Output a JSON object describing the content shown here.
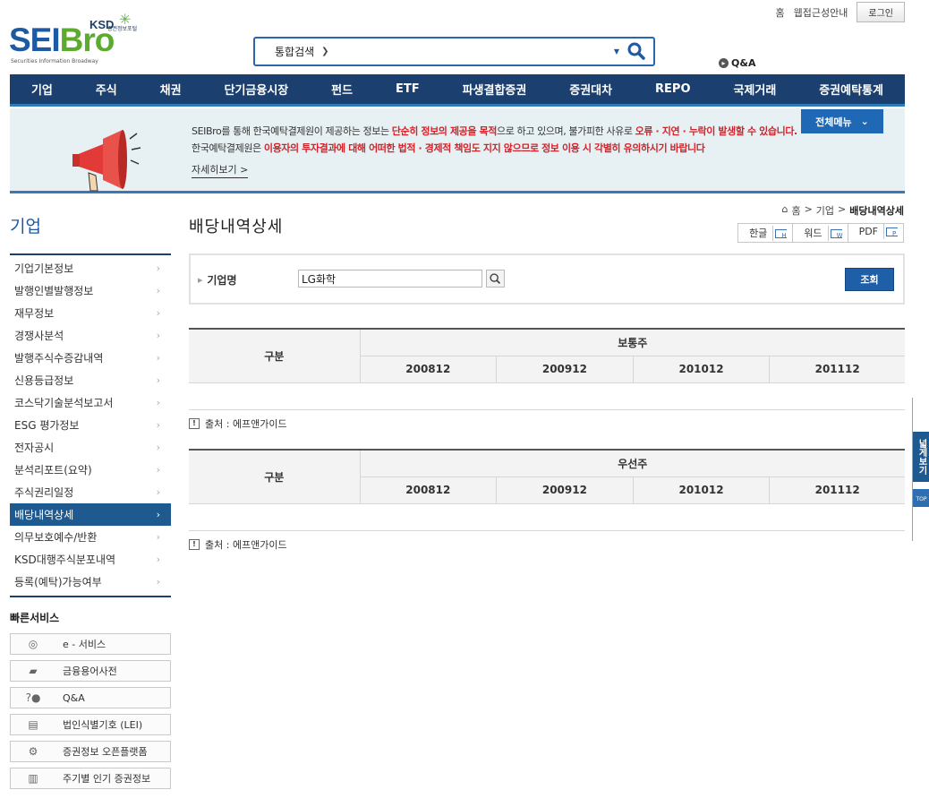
{
  "util": {
    "home": "홈",
    "accessibility": "웹접근성안내",
    "login": "로그인"
  },
  "logo": {
    "ksd": "KSD",
    "portal": "증권정보포털",
    "seibro_sei": "SEI",
    "seibro_bro": "Bro",
    "tagline": "Securities Information Broadway"
  },
  "search": {
    "category": "통합검색"
  },
  "qna_top": "Q&A",
  "gnb": [
    "기업",
    "주식",
    "채권",
    "단기금융시장",
    "펀드",
    "ETF",
    "파생결합증권",
    "증권대차",
    "REPO",
    "국제거래",
    "증권예탁통계"
  ],
  "notice": {
    "l1_a": "SEIBro를 통해 한국예탁결제원이 제공하는 정보는 ",
    "l1_b": "단순히 정보의 제공을 목적",
    "l1_c": "으로 하고 있으며, 불가피한 사유로 ",
    "l1_d": "오류 · 지연 · 누락이 발생할 수 있습니다.",
    "l2_a": "한국예탁결제원은 ",
    "l2_b": "이용자의 투자결과에 대해 어떠한 법적 · 경제적 책임도 지지 않으므로 정보 이용 시 각별히 유의하시기 바랍니다",
    "more": "자세히보기 >",
    "allmenu": "전체메뉴"
  },
  "lnb": {
    "title": "기업",
    "items": [
      "기업기본정보",
      "발행인별발행정보",
      "재무정보",
      "경쟁사분석",
      "발행주식수증감내역",
      "신용등급정보",
      "코스닥기술분석보고서",
      "ESG 평가정보",
      "전자공시",
      "분석리포트(요약)",
      "주식권리일정",
      "배당내역상세",
      "의무보호예수/반환",
      "KSD대행주식분포내역",
      "등록(예탁)가능여부"
    ],
    "active_index": 11
  },
  "quick": {
    "title": "빠른서비스",
    "items": [
      "e - 서비스",
      "금융용어사전",
      "Q&A",
      "법인식별기호 (LEI)",
      "증권정보 오픈플랫폼",
      "주기별 인기 증권정보"
    ]
  },
  "content": {
    "title": "배당내역상세",
    "breadcrumb": [
      "홈",
      ">",
      "기업",
      ">",
      "배당내역상세"
    ],
    "downloads": [
      "한글",
      "워드",
      "PDF"
    ],
    "search_label": "기업명",
    "search_value": "LG화학",
    "search_button": "조회"
  },
  "tables": [
    {
      "col_label": "구분",
      "group": "보통주",
      "years": [
        "200812",
        "200912",
        "201012",
        "201112"
      ]
    },
    {
      "col_label": "구분",
      "group": "우선주",
      "years": [
        "200812",
        "200912",
        "201012",
        "201112"
      ]
    }
  ],
  "source": "출처 : 에프앤가이드",
  "side": {
    "wide": "넓게보기",
    "top": "TOP"
  }
}
